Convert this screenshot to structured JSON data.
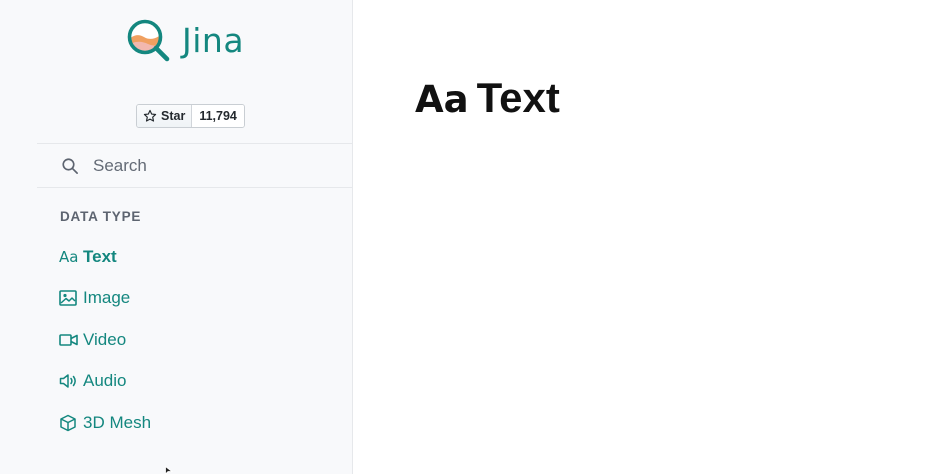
{
  "brand": {
    "name": "Jina",
    "logo_icon": "jina-magnifier-logo",
    "colors": {
      "teal": "#14877f",
      "orange": "#f0a060",
      "pink": "#f2b8ae"
    }
  },
  "github": {
    "star_label": "Star",
    "star_count": "11,794"
  },
  "search": {
    "placeholder": "Search"
  },
  "sidebar": {
    "section_label": "DATA TYPE",
    "items": [
      {
        "icon": "Aa",
        "label": "Text",
        "active": true
      },
      {
        "icon": "image-icon",
        "label": "Image"
      },
      {
        "icon": "video-icon",
        "label": "Video"
      },
      {
        "icon": "audio-icon",
        "label": "Audio"
      },
      {
        "icon": "cube-icon",
        "label": "3D Mesh"
      }
    ]
  },
  "main": {
    "title_icon": "Aa",
    "title": "Text"
  }
}
